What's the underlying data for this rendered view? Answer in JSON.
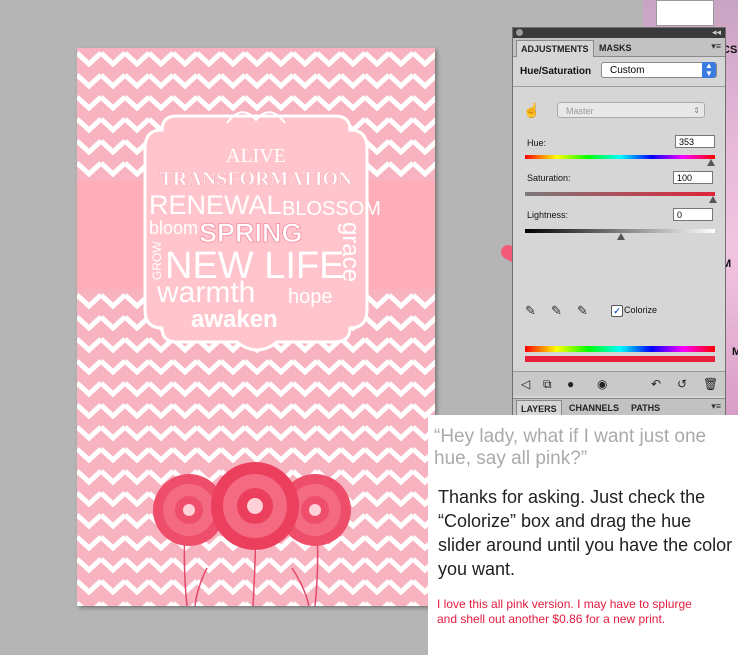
{
  "poster": {
    "words": {
      "alive": "ALIVE",
      "transformation": "TRANSFORMATION",
      "renewal": "RENEWAL",
      "blossom": "BLOSSOM",
      "bloom": "bloom",
      "spring": "SPRING",
      "grace": "grace",
      "grow": "GROW",
      "new_life": "NEW LIFE",
      "warmth": "warmth",
      "hope": "hope",
      "awaken": "awaken"
    }
  },
  "ps_panel": {
    "tabs": [
      "ADJUSTMENTS",
      "MASKS"
    ],
    "title": "Hue/Saturation",
    "preset": "Custom",
    "channel": "Master",
    "hue_label": "Hue:",
    "hue_value": "353",
    "saturation_label": "Saturation:",
    "saturation_value": "100",
    "lightness_label": "Lightness:",
    "lightness_value": "0",
    "colorize_label": "Colorize",
    "colorize_checked": true,
    "bottom_tabs": [
      "LAYERS",
      "CHANNELS",
      "PATHS"
    ]
  },
  "desktop": {
    "label_cs": "CS",
    "label_m1": "M",
    "label_m2": "M"
  },
  "note": {
    "question": "“Hey lady, what if I want just one hue, say all pink?”",
    "answer": "Thanks for asking.  Just check the “Colorize” box and drag the hue slider around until you have the color you want.",
    "comment": "I love this all pink version.  I may have to splurge and shell out another $0.86 for a new print."
  },
  "colors": {
    "poster_bg": "#f7b3bf",
    "ribbon": "#ffadb8",
    "flower": "#ee4e6a",
    "accent_red": "#e31b3e",
    "arrow": "#f25c7a"
  }
}
